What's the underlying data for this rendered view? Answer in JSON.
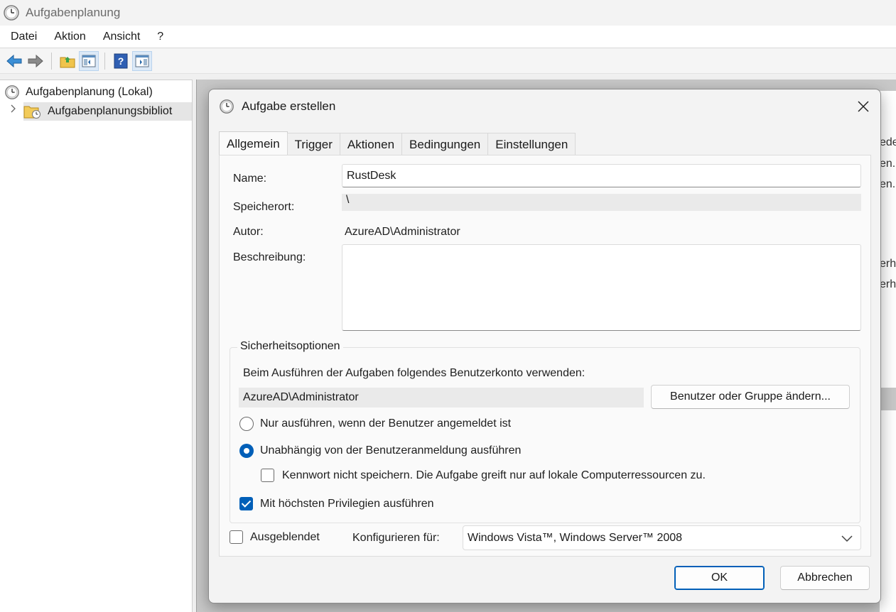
{
  "window": {
    "title": "Aufgabenplanung"
  },
  "menu": [
    "Datei",
    "Aktion",
    "Ansicht",
    "?"
  ],
  "toolbar": {
    "icons": [
      "back-arrow-icon",
      "forward-arrow-icon",
      "folder-up-icon",
      "show-hide-console-tree-icon",
      "help-icon",
      "show-hide-action-pane-icon"
    ]
  },
  "tree": {
    "root": "Aufgabenplanung (Lokal)",
    "child": "Aufgabenplanungsbibliot"
  },
  "background_fragments": [
    "ede",
    "en.",
    "en.",
    "erh",
    "erh"
  ],
  "dialog": {
    "title": "Aufgabe erstellen",
    "tabs": [
      "Allgemein",
      "Trigger",
      "Aktionen",
      "Bedingungen",
      "Einstellungen"
    ],
    "active_tab": "Allgemein",
    "name_label": "Name:",
    "name_value": "RustDesk",
    "location_label": "Speicherort:",
    "location_value": "\\",
    "author_label": "Autor:",
    "author_value": "AzureAD\\Administrator",
    "description_label": "Beschreibung:",
    "description_value": "",
    "security": {
      "legend": "Sicherheitsoptionen",
      "account_prompt": "Beim Ausführen der Aufgaben folgendes Benutzerkonto verwenden:",
      "account_value": "AzureAD\\Administrator",
      "change_user_button": "Benutzer oder Gruppe ändern...",
      "radio_logged_on": "Nur ausführen, wenn der Benutzer angemeldet ist",
      "radio_logged_on_checked": false,
      "radio_independent": "Unabhängig von der Benutzeranmeldung ausführen",
      "radio_independent_checked": true,
      "no_store_password": "Kennwort nicht speichern. Die Aufgabe greift nur auf lokale Computerressourcen zu.",
      "no_store_password_checked": false,
      "highest_privileges": "Mit höchsten Privilegien ausführen",
      "highest_privileges_checked": true
    },
    "hidden_label": "Ausgeblendet",
    "hidden_checked": false,
    "configure_label": "Konfigurieren für:",
    "configure_value": "Windows Vista™, Windows Server™ 2008",
    "ok_button": "OK",
    "cancel_button": "Abbrechen"
  }
}
